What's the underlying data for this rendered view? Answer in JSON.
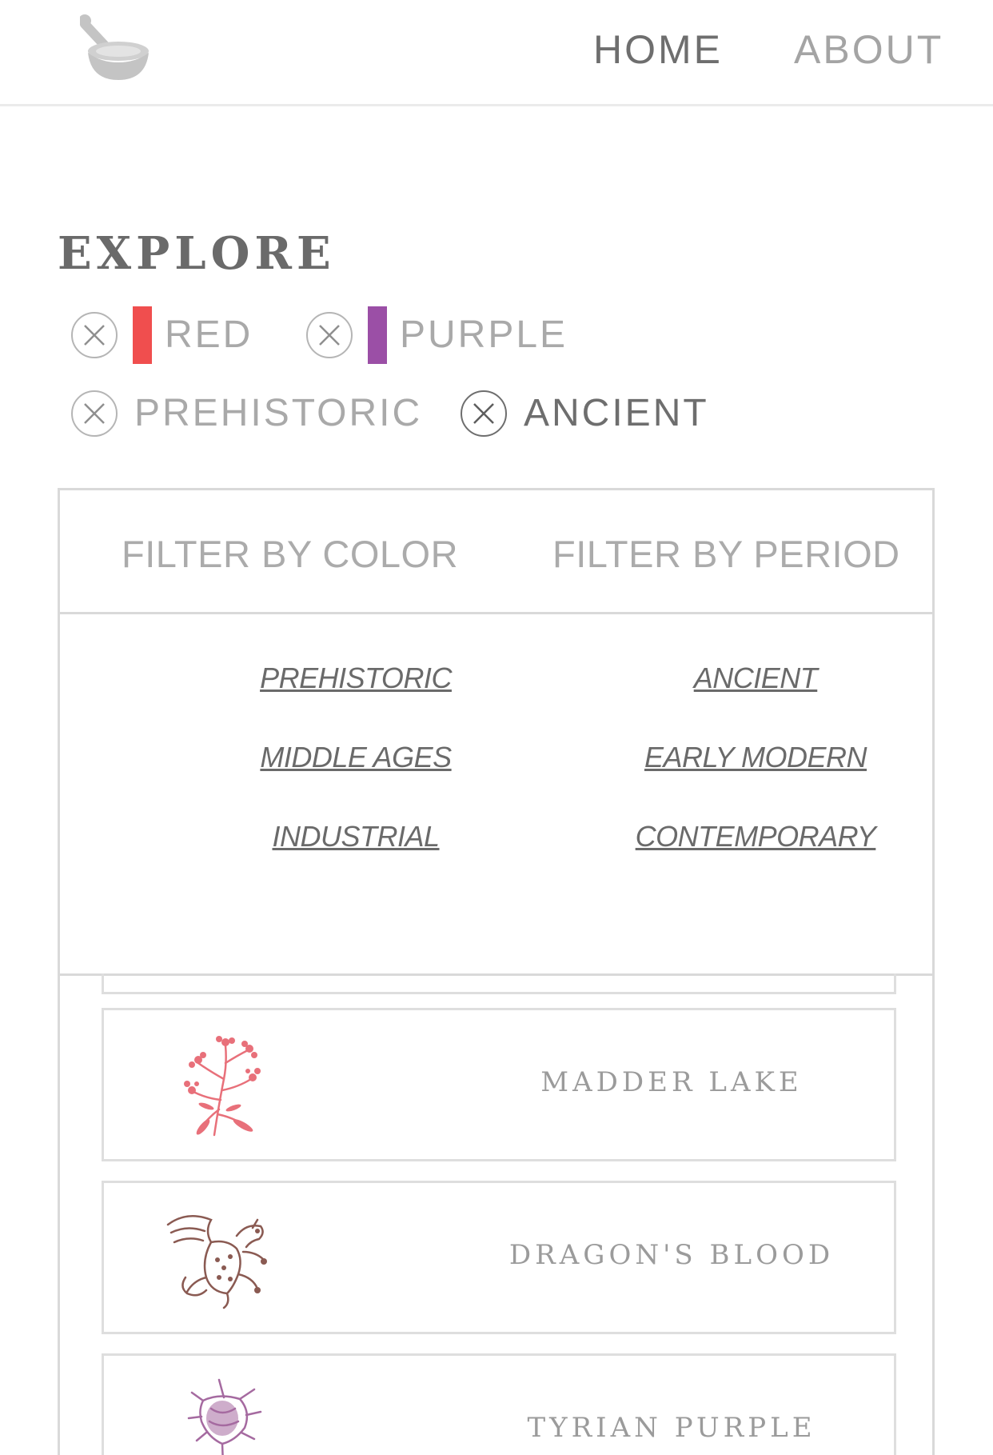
{
  "nav": {
    "logo_icon": "mortar-and-pestle-icon",
    "home_label": "HOME",
    "about_label": "ABOUT"
  },
  "explore": {
    "title": "EXPLORE",
    "active_filters": [
      {
        "label": "RED",
        "type": "color",
        "swatch_color": "#f04e4e"
      },
      {
        "label": "PURPLE",
        "type": "color",
        "swatch_color": "#9b4fa6"
      },
      {
        "label": "PREHISTORIC",
        "type": "period"
      },
      {
        "label": "ANCIENT",
        "type": "period"
      }
    ]
  },
  "filter_panel": {
    "tabs": [
      "FILTER BY COLOR",
      "FILTER BY PERIOD"
    ],
    "periods": [
      "PREHISTORIC",
      "ANCIENT",
      "MIDDLE AGES",
      "EARLY MODERN",
      "INDUSTRIAL",
      "CONTEMPORARY"
    ]
  },
  "pigments": [
    {
      "name": "MADDER LAKE",
      "icon": "madder-plant-icon",
      "color": "#e8707a"
    },
    {
      "name": "DRAGON'S BLOOD",
      "icon": "dragon-icon",
      "color": "#8a5a52"
    },
    {
      "name": "TYRIAN PURPLE",
      "icon": "murex-shell-icon",
      "color": "#a56aa0"
    }
  ]
}
